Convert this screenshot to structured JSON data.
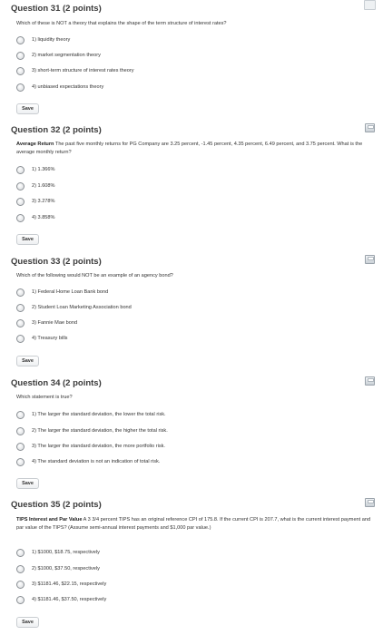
{
  "questions": [
    {
      "heading": "Question 31 (2 points)",
      "prompt_bold": "",
      "prompt_text": "Which of these is NOT a theory that explains the shape of the term structure of interest rates?",
      "options": [
        "1) liquidity theory",
        "2) market segmentation theory",
        "3) short-term structure of interest rates theory",
        "4) unbiased expectations theory"
      ],
      "save_label": "Save"
    },
    {
      "heading": "Question 32 (2 points)",
      "prompt_bold": "Average Return",
      "prompt_text": " The past five monthly returns for PG Company are 3.25 percent, -1.45 percent, 4.35 percent, 6.49 percent, and 3.75 percent. What is the average monthly return?",
      "options": [
        "1) 1.366%",
        "2) 1.608%",
        "3) 3.278%",
        "4) 3.858%"
      ],
      "save_label": "Save"
    },
    {
      "heading": "Question 33 (2 points)",
      "prompt_bold": "",
      "prompt_text": "Which of the following would NOT be an example of an agency bond?",
      "options": [
        "1) Federal Home Loan Bank bond",
        "2) Student Loan Marketing Association bond",
        "3) Fannie Mae bond",
        "4) Treasury bills"
      ],
      "save_label": "Save"
    },
    {
      "heading": "Question 34 (2 points)",
      "prompt_bold": "",
      "prompt_text": "Which statement is true?",
      "options": [
        "1) The larger the standard deviation, the lower the total risk.",
        "2) The larger the standard deviation, the higher the total risk.",
        "3) The larger the standard deviation, the more portfolio risk.",
        "4) The standard deviation is not an indication of total risk."
      ],
      "save_label": "Save"
    },
    {
      "heading": "Question 35 (2 points)",
      "prompt_bold": "TIPS Interest and Par Value",
      "prompt_text": " A 3 3/4 percent TIPS has an original reference CPI of 175.8. If the current CPI is 207.7, what is the current interest payment and par value of the TIPS? (Assume semi-annual interest payments and $1,000 par value.)",
      "options": [
        "1) $1000, $18.75, respectively",
        "2) $1000, $37.50, respectively",
        "3) $1181.46, $22.15, respectively",
        "4) $1181.46, $37.50, respectively"
      ],
      "save_label": "Save"
    }
  ]
}
